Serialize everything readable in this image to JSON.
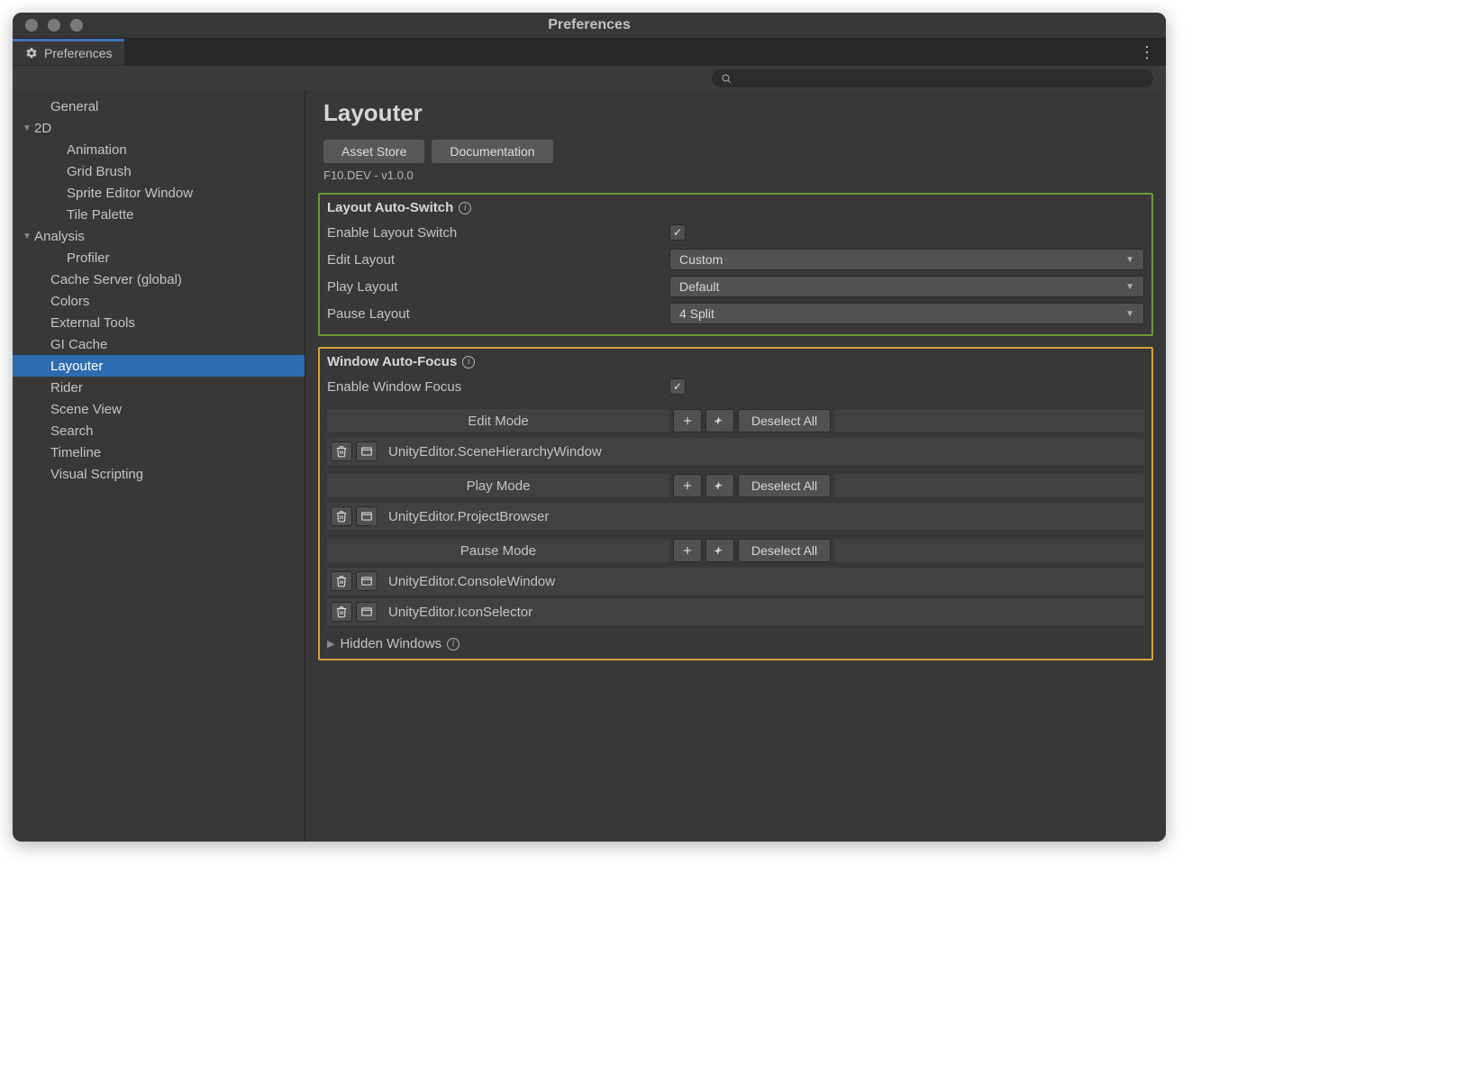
{
  "window": {
    "title": "Preferences"
  },
  "tab": {
    "label": "Preferences"
  },
  "search": {
    "placeholder": ""
  },
  "sidebar": {
    "items": [
      {
        "label": "General",
        "depth": 1,
        "arrow": ""
      },
      {
        "label": "2D",
        "depth": 0,
        "arrow": "▼"
      },
      {
        "label": "Animation",
        "depth": 2,
        "arrow": ""
      },
      {
        "label": "Grid Brush",
        "depth": 2,
        "arrow": ""
      },
      {
        "label": "Sprite Editor Window",
        "depth": 2,
        "arrow": ""
      },
      {
        "label": "Tile Palette",
        "depth": 2,
        "arrow": ""
      },
      {
        "label": "Analysis",
        "depth": 0,
        "arrow": "▼"
      },
      {
        "label": "Profiler",
        "depth": 2,
        "arrow": ""
      },
      {
        "label": "Cache Server (global)",
        "depth": 1,
        "arrow": ""
      },
      {
        "label": "Colors",
        "depth": 1,
        "arrow": ""
      },
      {
        "label": "External Tools",
        "depth": 1,
        "arrow": ""
      },
      {
        "label": "GI Cache",
        "depth": 1,
        "arrow": ""
      },
      {
        "label": "Layouter",
        "depth": 1,
        "arrow": "",
        "selected": true
      },
      {
        "label": "Rider",
        "depth": 1,
        "arrow": ""
      },
      {
        "label": "Scene View",
        "depth": 1,
        "arrow": ""
      },
      {
        "label": "Search",
        "depth": 1,
        "arrow": ""
      },
      {
        "label": "Timeline",
        "depth": 1,
        "arrow": ""
      },
      {
        "label": "Visual Scripting",
        "depth": 1,
        "arrow": ""
      }
    ]
  },
  "content": {
    "title": "Layouter",
    "buttons": {
      "asset_store": "Asset Store",
      "docs": "Documentation"
    },
    "version": "F10.DEV - v1.0.0",
    "layout_section": {
      "title": "Layout Auto-Switch",
      "enable_label": "Enable Layout Switch",
      "enable_checked": true,
      "edit_label": "Edit Layout",
      "edit_value": "Custom",
      "play_label": "Play Layout",
      "play_value": "Default",
      "pause_label": "Pause Layout",
      "pause_value": "4 Split"
    },
    "focus_section": {
      "title": "Window Auto-Focus",
      "enable_label": "Enable Window Focus",
      "enable_checked": true,
      "deselect_label": "Deselect All",
      "modes": [
        {
          "title": "Edit Mode",
          "entries": [
            "UnityEditor.SceneHierarchyWindow"
          ]
        },
        {
          "title": "Play Mode",
          "entries": [
            "UnityEditor.ProjectBrowser"
          ]
        },
        {
          "title": "Pause Mode",
          "entries": [
            "UnityEditor.ConsoleWindow",
            "UnityEditor.IconSelector"
          ]
        }
      ],
      "hidden_label": "Hidden Windows"
    }
  }
}
